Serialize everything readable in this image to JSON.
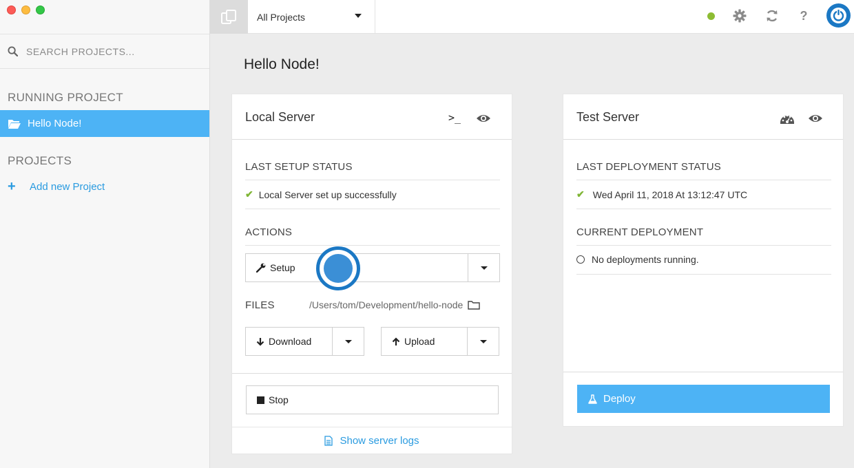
{
  "sidebar": {
    "search_placeholder": "SEARCH PROJECTS...",
    "running_label": "RUNNING PROJECT",
    "running_project": "Hello Node!",
    "projects_label": "PROJECTS",
    "add_project": "Add new Project"
  },
  "topbar": {
    "project_select": "All Projects",
    "status_color": "#8dbc33",
    "icons": [
      "projects-icon",
      "gear-icon",
      "refresh-icon",
      "help-icon",
      "power-icon"
    ]
  },
  "main": {
    "page_title": "Hello Node!"
  },
  "local": {
    "title": "Local Server",
    "last_setup_label": "LAST SETUP STATUS",
    "setup_status": "Local Server set up successfully",
    "actions_label": "ACTIONS",
    "setup_button": "Setup",
    "files_label": "FILES",
    "files_path": "/Users/tom/Development/hello-node",
    "download_button": "Download",
    "upload_button": "Upload",
    "stop_button": "Stop",
    "logs_link": "Show server logs"
  },
  "test": {
    "title": "Test Server",
    "last_deploy_label": "LAST DEPLOYMENT STATUS",
    "deploy_status": "Wed April 11, 2018 At 13:12:47 UTC",
    "current_label": "CURRENT DEPLOYMENT",
    "current_status": "No deployments running.",
    "deploy_button": "Deploy"
  },
  "colors": {
    "accent": "#4db3f5",
    "link": "#2a9be0",
    "brand": "#1b78c4",
    "success": "#7fb535"
  }
}
